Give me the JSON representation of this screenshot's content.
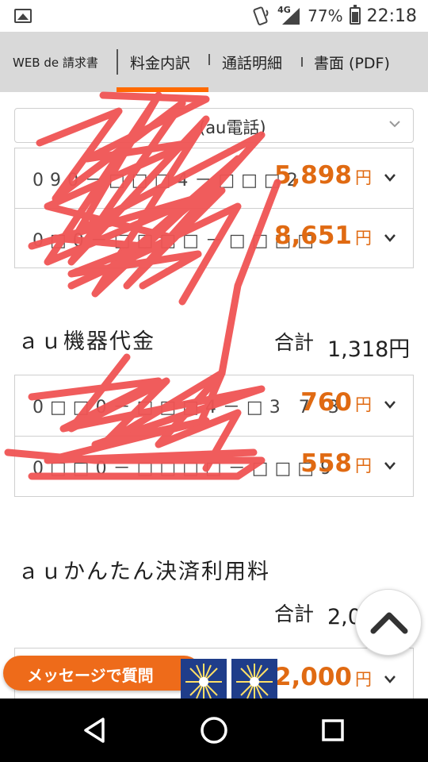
{
  "status_bar": {
    "network": "4G",
    "battery": "77%",
    "time": "22:18"
  },
  "tabs": [
    {
      "label": "WEB de 請求書"
    },
    {
      "label": "料金内訳"
    },
    {
      "label": "通話明細"
    },
    {
      "label": "書面 (PDF)"
    }
  ],
  "select": {
    "value_visible": "(au電話)"
  },
  "phone_rows": [
    {
      "number": "090－□□□4－□□□2",
      "amount": "5,898",
      "yen": "円"
    },
    {
      "number": "0□0－□□□□－□□□□",
      "amount": "8,651",
      "yen": "円"
    }
  ],
  "au_device": {
    "title": "ａｕ機器代金",
    "total_label": "合計",
    "total_value": "1,318円",
    "rows": [
      {
        "number": "0□□0－□□□4－□3 7 3",
        "amount": "760",
        "yen": "円"
      },
      {
        "number": "0□□0－□□□□－□□□9",
        "amount": "558",
        "yen": "円"
      }
    ]
  },
  "au_kantan": {
    "title": "ａｕかんたん決済利用料",
    "total_label": "合計",
    "total_value_partial": "2,0",
    "rows": [
      {
        "amount": "2,000",
        "yen": "円"
      }
    ]
  },
  "message_button": {
    "label": "メッセージで質問"
  },
  "colors": {
    "accent_orange": "#e06a12",
    "tab_underline": "#ff6a00",
    "scribble_red": "#f05454"
  }
}
